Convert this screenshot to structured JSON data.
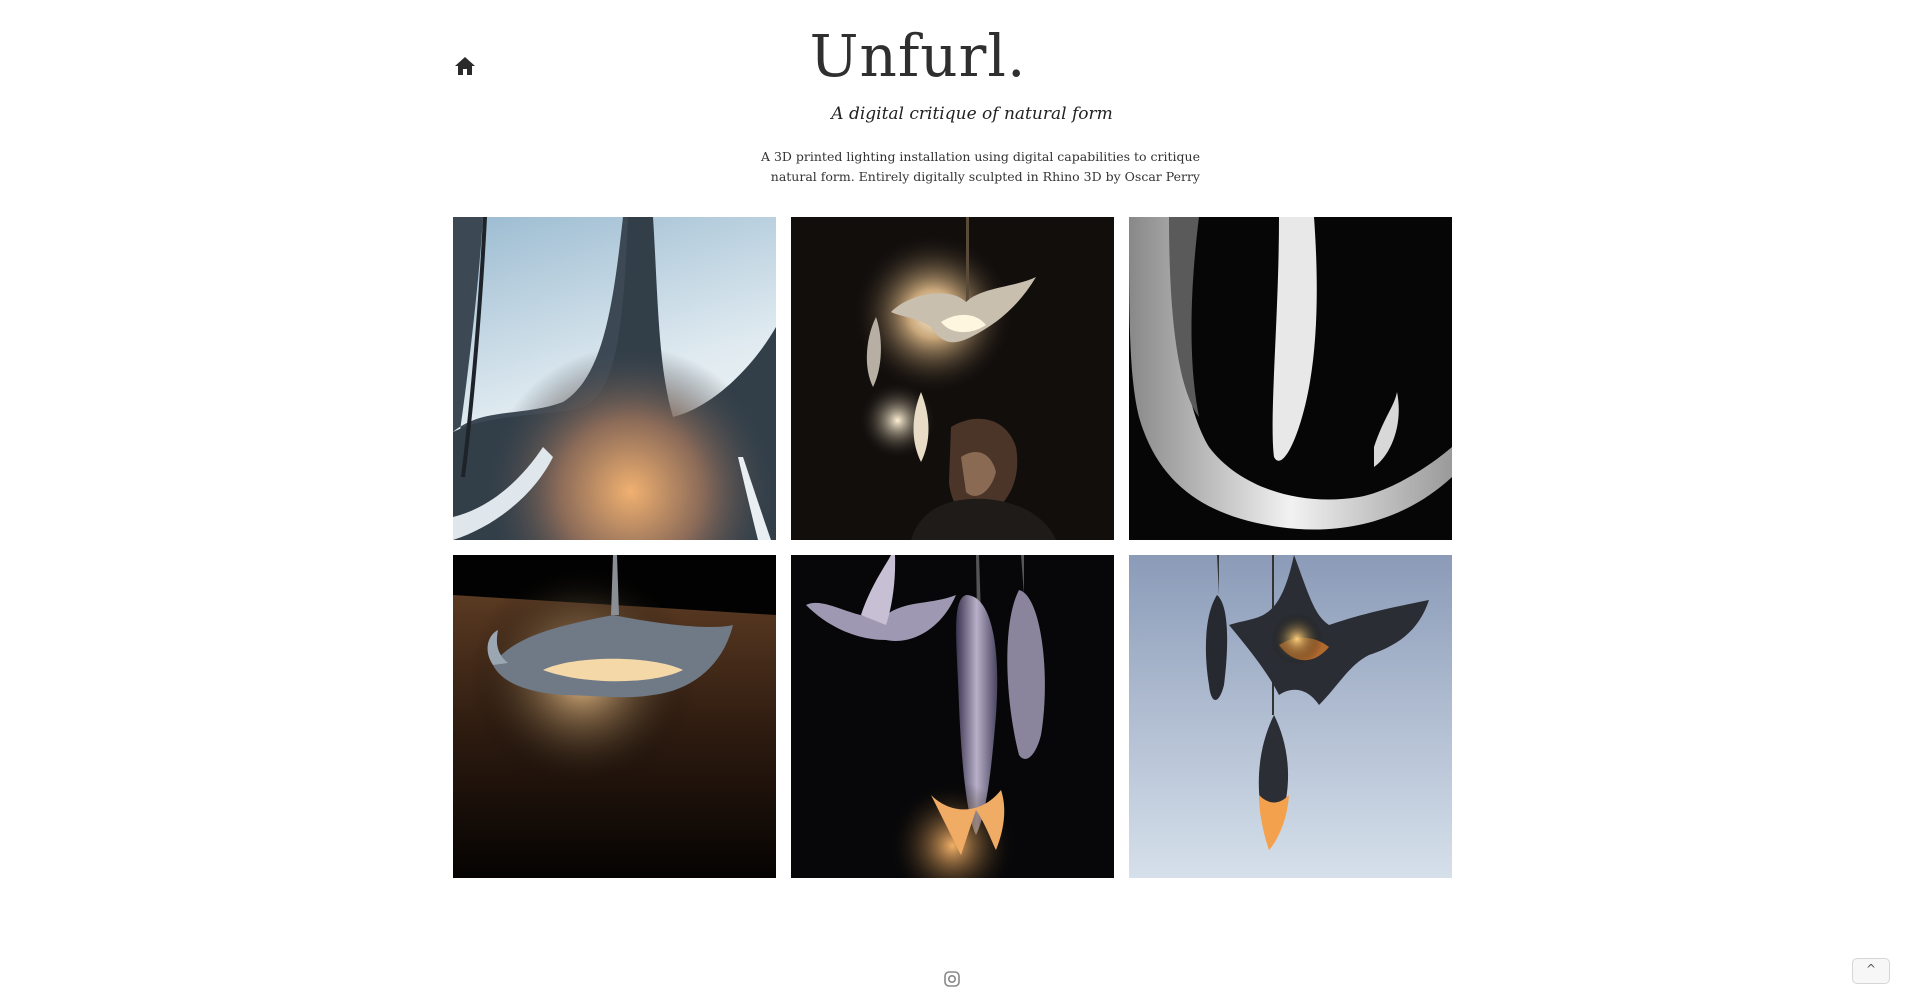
{
  "header": {
    "home_icon": "home-icon",
    "title": "Unfurl.",
    "subtitle": "A digital critique of natural form",
    "description": "A 3D printed lighting installation using digital capabilities to critique natural form. Entirely digitally sculpted in Rhino 3D by Oscar Perry"
  },
  "gallery": {
    "images": [
      {
        "subject": "black petal lamp against pale blue sky, glowing"
      },
      {
        "subject": "man looking up at glowing flower pendants in dark room"
      },
      {
        "subject": "white flower pendant close-up on black background"
      },
      {
        "subject": "flower pendant glowing over wooden panel"
      },
      {
        "subject": "cluster of lilac flower pendants in dark"
      },
      {
        "subject": "dark flower pendants glowing against pale sky"
      }
    ]
  },
  "footer": {
    "icon": "instagram-icon",
    "scroll_top_label": "^"
  }
}
